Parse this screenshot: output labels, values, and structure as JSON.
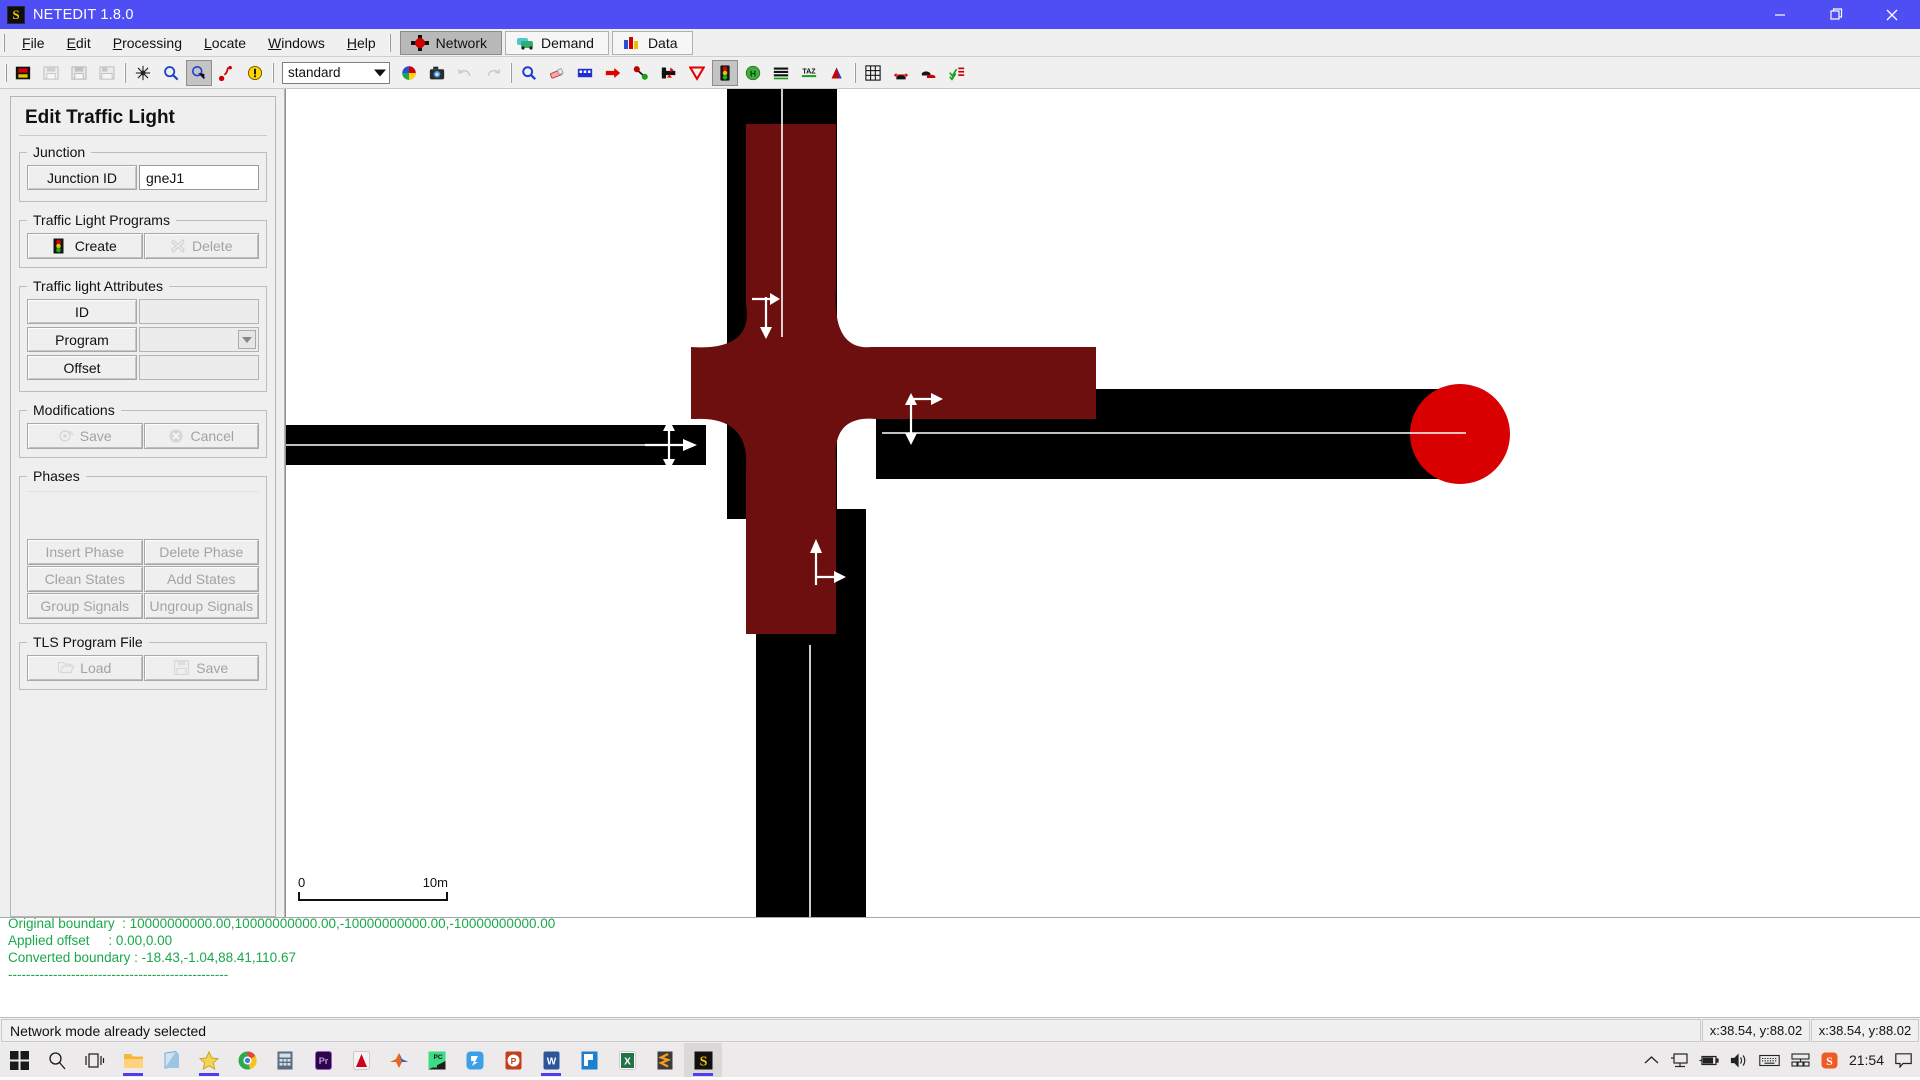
{
  "window": {
    "title": "NETEDIT 1.8.0",
    "app_icon": "netedit-icon",
    "minimize": "minimize-icon",
    "maximize": "maximize-icon",
    "close": "close-icon"
  },
  "menu": {
    "items": [
      {
        "label": "File",
        "mnemonic": "F"
      },
      {
        "label": "Edit",
        "mnemonic": "E"
      },
      {
        "label": "Processing",
        "mnemonic": "P"
      },
      {
        "label": "Locate",
        "mnemonic": "L"
      },
      {
        "label": "Windows",
        "mnemonic": "W"
      },
      {
        "label": "Help",
        "mnemonic": "H"
      }
    ]
  },
  "supermode_tabs": [
    {
      "label": "Network",
      "icon": "network-icon",
      "active": true
    },
    {
      "label": "Demand",
      "icon": "demand-icon",
      "active": false
    },
    {
      "label": "Data",
      "icon": "data-icon",
      "active": false
    }
  ],
  "toolbar": {
    "buttons": [
      {
        "name": "new-network-button",
        "icon": "new-network-icon",
        "enabled": true
      },
      {
        "name": "open-network-button",
        "icon": "open-folder-icon",
        "enabled": false
      },
      {
        "name": "save-network-button",
        "icon": "save-icon",
        "enabled": false
      },
      {
        "name": "save-as-button",
        "icon": "save-as-icon",
        "enabled": false
      },
      {
        "name": "recenter-view-button",
        "icon": "recenter-icon",
        "enabled": true
      },
      {
        "name": "zoom-button",
        "icon": "magnifier-icon",
        "enabled": true
      },
      {
        "name": "edit-viewport-button",
        "icon": "viewport-icon",
        "enabled": true
      },
      {
        "name": "help-button",
        "icon": "question-icon",
        "enabled": true
      },
      {
        "name": "locator-button",
        "icon": "exclamation-icon",
        "enabled": true
      },
      {
        "name": "color-scheme-button",
        "icon": "color-wheel-icon",
        "enabled": true
      },
      {
        "name": "snapshot-button",
        "icon": "camera-icon",
        "enabled": true
      },
      {
        "name": "undo-button",
        "icon": "undo-icon",
        "enabled": false
      },
      {
        "name": "redo-button",
        "icon": "redo-icon",
        "enabled": false
      },
      {
        "name": "inspect-mode-button",
        "icon": "inspect-magnifier-icon",
        "enabled": true
      },
      {
        "name": "delete-mode-button",
        "icon": "eraser-icon",
        "enabled": true
      },
      {
        "name": "select-mode-button",
        "icon": "select-icon",
        "enabled": true
      },
      {
        "name": "move-mode-button",
        "icon": "move-arrow-icon",
        "enabled": true
      },
      {
        "name": "create-edge-mode-button",
        "icon": "create-edge-icon",
        "enabled": true
      },
      {
        "name": "connection-mode-button",
        "icon": "connection-icon",
        "enabled": true
      },
      {
        "name": "prohibition-mode-button",
        "icon": "yield-triangle-icon",
        "enabled": true
      },
      {
        "name": "traffic-light-mode-button",
        "icon": "traffic-light-icon",
        "enabled": true,
        "pressed": true
      },
      {
        "name": "additional-mode-button",
        "icon": "additional-icon",
        "enabled": true
      },
      {
        "name": "crossing-mode-button",
        "icon": "crossing-icon",
        "enabled": true
      },
      {
        "name": "taz-mode-button",
        "icon": "taz-icon",
        "enabled": true
      },
      {
        "name": "shape-mode-button",
        "icon": "shape-polygon-icon",
        "enabled": true
      },
      {
        "name": "grid-toggle-button",
        "icon": "grid-icon",
        "enabled": true
      },
      {
        "name": "draw-junction-shape-button",
        "icon": "junction-shape-icon",
        "enabled": true
      },
      {
        "name": "show-connections-button",
        "icon": "vehicle-icon",
        "enabled": true
      },
      {
        "name": "select-edges-button",
        "icon": "checklist-icon",
        "enabled": true
      }
    ],
    "edit_mode_combo": {
      "value": "standard",
      "name": "edit-mode-combo"
    }
  },
  "panel": {
    "title": "Edit Traffic Light",
    "junction": {
      "legend": "Junction",
      "id_label": "Junction ID",
      "id_value": "gneJ1"
    },
    "programs": {
      "legend": "Traffic Light Programs",
      "create_label": "Create",
      "delete_label": "Delete"
    },
    "attributes": {
      "legend": "Traffic light Attributes",
      "id_label": "ID",
      "id_value": "",
      "program_label": "Program",
      "program_value": "",
      "offset_label": "Offset",
      "offset_value": ""
    },
    "modifications": {
      "legend": "Modifications",
      "save_label": "Save",
      "cancel_label": "Cancel"
    },
    "phases": {
      "legend": "Phases",
      "insert_phase": "Insert Phase",
      "delete_phase": "Delete Phase",
      "clean_states": "Clean States",
      "add_states": "Add States",
      "group_signals": "Group Signals",
      "ungroup_signals": "Ungroup Signals"
    },
    "tls_file": {
      "legend": "TLS Program File",
      "load_label": "Load",
      "save_label": "Save"
    }
  },
  "canvas": {
    "scale": {
      "zero": "0",
      "distance": "10m"
    },
    "colors": {
      "road": "#000000",
      "junction": "#6e0f0f",
      "endpoint": "#d80000",
      "background": "#ffffff",
      "lane_marking": "#ffffff"
    }
  },
  "log": {
    "lines": [
      "Original boundary  : 10000000000.00,10000000000.00,-10000000000.00,-10000000000.00",
      "Applied offset     : 0.00,0.00",
      "Converted boundary : -18.43,-1.04,88.41,110.67",
      "-------------------------------------------------"
    ]
  },
  "statusbar": {
    "message": "Network mode already selected",
    "cursor_position": "x:38.54, y:88.02",
    "network_position": "x:38.54, y:88.02"
  },
  "taskbar": {
    "start": "windows-start-icon",
    "items": [
      {
        "name": "search-icon",
        "glyph": "search"
      },
      {
        "name": "task-view-icon",
        "glyph": "taskview"
      },
      {
        "name": "file-explorer-icon",
        "glyph": "folder",
        "running": true
      },
      {
        "name": "store-icon",
        "glyph": "store"
      },
      {
        "name": "star-app-icon",
        "glyph": "star",
        "running": true
      },
      {
        "name": "chrome-icon",
        "glyph": "chrome"
      },
      {
        "name": "calculator-icon",
        "glyph": "calculator"
      },
      {
        "name": "premiere-icon",
        "glyph": "pr"
      },
      {
        "name": "acrobat-icon",
        "glyph": "acrobat"
      },
      {
        "name": "matlab-icon",
        "glyph": "matlab"
      },
      {
        "name": "pycharm-icon",
        "glyph": "pycharm"
      },
      {
        "name": "wechat-icon",
        "glyph": "wechat"
      },
      {
        "name": "powerpoint-icon",
        "glyph": "ppt"
      },
      {
        "name": "word-icon",
        "glyph": "word",
        "running": true
      },
      {
        "name": "editor-icon",
        "glyph": "editor"
      },
      {
        "name": "excel-icon",
        "glyph": "excel"
      },
      {
        "name": "sublime-icon",
        "glyph": "sublime"
      },
      {
        "name": "netedit-taskbar-icon",
        "glyph": "netedit",
        "running": true,
        "active": true
      }
    ],
    "tray": [
      {
        "name": "show-hidden-icons-chevron"
      },
      {
        "name": "network-tray-icon"
      },
      {
        "name": "battery-tray-icon"
      },
      {
        "name": "volume-tray-icon"
      },
      {
        "name": "keyboard-tray-icon"
      },
      {
        "name": "ime-tray-icon"
      },
      {
        "name": "sogou-tray-icon"
      }
    ],
    "clock": "21:54",
    "notification": "notification-icon"
  }
}
